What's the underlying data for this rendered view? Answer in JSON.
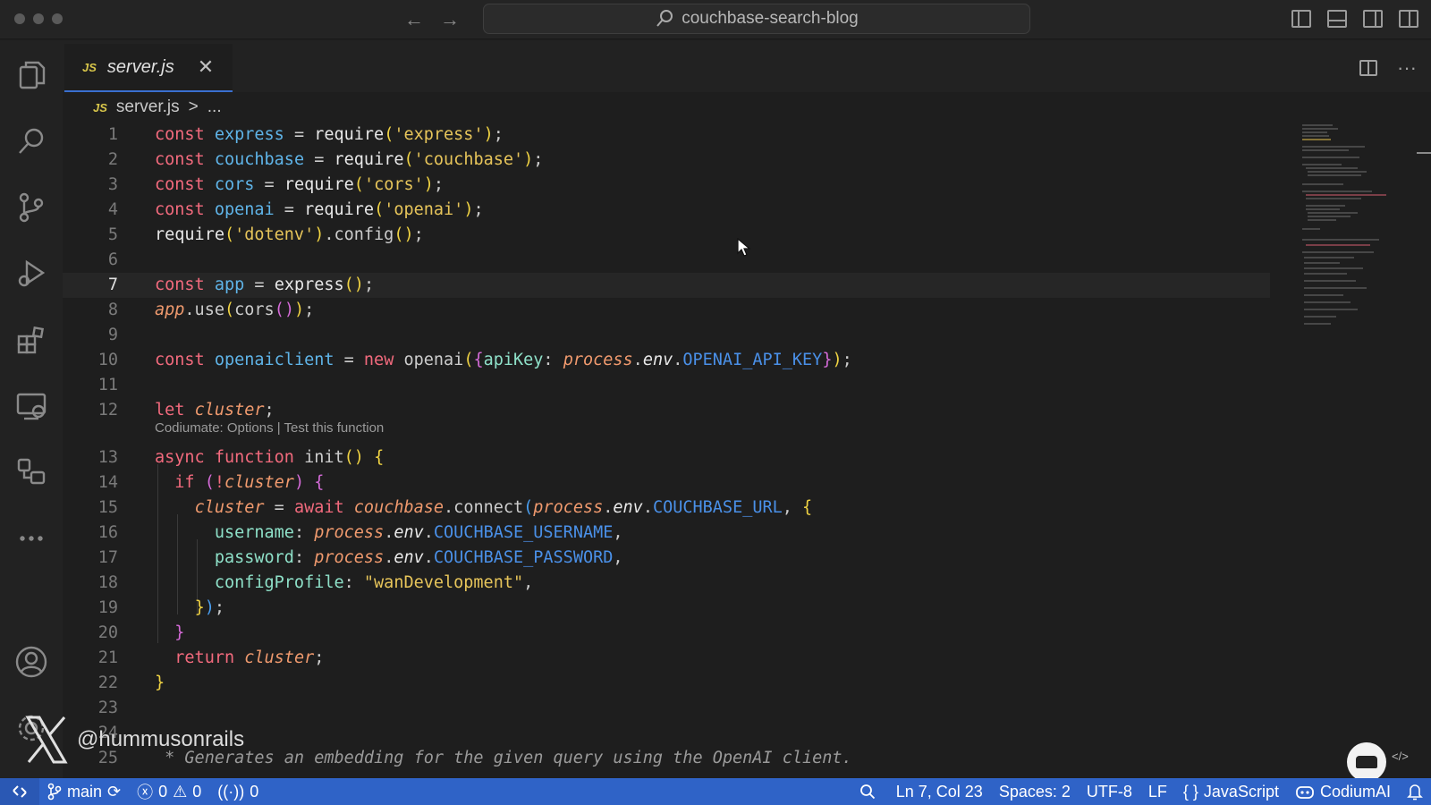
{
  "window": {
    "search_title": "couchbase-search-blog",
    "back_glyph": "←",
    "forward_glyph": "→"
  },
  "tab": {
    "badge": "JS",
    "title": "server.js",
    "close_glyph": "✕",
    "more_glyph": "···"
  },
  "breadcrumb": {
    "badge": "JS",
    "file": "server.js",
    "separator": ">",
    "more": "..."
  },
  "editor": {
    "current_line": 7,
    "line_numbers": [
      "1",
      "2",
      "3",
      "4",
      "5",
      "6",
      "7",
      "8",
      "9",
      "10",
      "11",
      "12",
      "13",
      "14",
      "15",
      "16",
      "17",
      "18",
      "19",
      "20",
      "21",
      "22",
      "23",
      "24",
      "25"
    ],
    "codelens": "Codiumate: Options | Test this function",
    "code": {
      "l1": [
        {
          "t": "const",
          "c": "kw"
        },
        {
          "t": " "
        },
        {
          "t": "express",
          "c": "var"
        },
        {
          "t": " = "
        },
        {
          "t": "require",
          "c": "fn"
        },
        {
          "t": "(",
          "c": "br"
        },
        {
          "t": "'express'",
          "c": "str"
        },
        {
          "t": ")",
          "c": "br"
        },
        {
          "t": ";"
        }
      ],
      "l2": [
        {
          "t": "const",
          "c": "kw"
        },
        {
          "t": " "
        },
        {
          "t": "couchbase",
          "c": "var"
        },
        {
          "t": " = "
        },
        {
          "t": "require",
          "c": "fn"
        },
        {
          "t": "(",
          "c": "br"
        },
        {
          "t": "'couchbase'",
          "c": "str"
        },
        {
          "t": ")",
          "c": "br"
        },
        {
          "t": ";"
        }
      ],
      "l3": [
        {
          "t": "const",
          "c": "kw"
        },
        {
          "t": " "
        },
        {
          "t": "cors",
          "c": "var"
        },
        {
          "t": " = "
        },
        {
          "t": "require",
          "c": "fn"
        },
        {
          "t": "(",
          "c": "br"
        },
        {
          "t": "'cors'",
          "c": "str"
        },
        {
          "t": ")",
          "c": "br"
        },
        {
          "t": ";"
        }
      ],
      "l4": [
        {
          "t": "const",
          "c": "kw"
        },
        {
          "t": " "
        },
        {
          "t": "openai",
          "c": "var"
        },
        {
          "t": " = "
        },
        {
          "t": "require",
          "c": "fn"
        },
        {
          "t": "(",
          "c": "br"
        },
        {
          "t": "'openai'",
          "c": "str"
        },
        {
          "t": ")",
          "c": "br"
        },
        {
          "t": ";"
        }
      ],
      "l5": [
        {
          "t": "require",
          "c": "fn"
        },
        {
          "t": "(",
          "c": "br"
        },
        {
          "t": "'dotenv'",
          "c": "str"
        },
        {
          "t": ")",
          "c": "br"
        },
        {
          "t": ".config"
        },
        {
          "t": "()",
          "c": "br"
        },
        {
          "t": ";"
        }
      ],
      "l6": [],
      "l7": [
        {
          "t": "const",
          "c": "kw"
        },
        {
          "t": " "
        },
        {
          "t": "app",
          "c": "var"
        },
        {
          "t": " = "
        },
        {
          "t": "express",
          "c": "fn"
        },
        {
          "t": "()",
          "c": "br"
        },
        {
          "t": ";"
        }
      ],
      "l8": [
        {
          "t": "app",
          "c": "it"
        },
        {
          "t": ".use"
        },
        {
          "t": "(",
          "c": "br"
        },
        {
          "t": "cors"
        },
        {
          "t": "()",
          "c": "br2"
        },
        {
          "t": ")",
          "c": "br"
        },
        {
          "t": ";"
        }
      ],
      "l9": [],
      "l10": [
        {
          "t": "const",
          "c": "kw"
        },
        {
          "t": " "
        },
        {
          "t": "openaiclient",
          "c": "var"
        },
        {
          "t": " = "
        },
        {
          "t": "new",
          "c": "kw"
        },
        {
          "t": " openai"
        },
        {
          "t": "(",
          "c": "br"
        },
        {
          "t": "{",
          "c": "br2"
        },
        {
          "t": "apiKey",
          "c": "prop"
        },
        {
          "t": ": "
        },
        {
          "t": "process",
          "c": "it"
        },
        {
          "t": "."
        },
        {
          "t": "env",
          "c": "itw"
        },
        {
          "t": "."
        },
        {
          "t": "OPENAI_API_KEY",
          "c": "cst"
        },
        {
          "t": "}",
          "c": "br2"
        },
        {
          "t": ")",
          "c": "br"
        },
        {
          "t": ";"
        }
      ],
      "l11": [],
      "l12": [
        {
          "t": "let",
          "c": "kw"
        },
        {
          "t": " "
        },
        {
          "t": "cluster",
          "c": "it"
        },
        {
          "t": ";"
        }
      ],
      "l13": [
        {
          "t": "async",
          "c": "kw"
        },
        {
          "t": " "
        },
        {
          "t": "function",
          "c": "kw"
        },
        {
          "t": " init"
        },
        {
          "t": "()",
          "c": "br"
        },
        {
          "t": " "
        },
        {
          "t": "{",
          "c": "br"
        }
      ],
      "l14": [
        {
          "t": "  "
        },
        {
          "t": "if",
          "c": "kw"
        },
        {
          "t": " "
        },
        {
          "t": "(",
          "c": "br2"
        },
        {
          "t": "!",
          "c": "kw"
        },
        {
          "t": "cluster",
          "c": "it"
        },
        {
          "t": ")",
          "c": "br2"
        },
        {
          "t": " "
        },
        {
          "t": "{",
          "c": "br2"
        }
      ],
      "l15": [
        {
          "t": "    "
        },
        {
          "t": "cluster",
          "c": "it"
        },
        {
          "t": " = "
        },
        {
          "t": "await",
          "c": "kw"
        },
        {
          "t": " "
        },
        {
          "t": "couchbase",
          "c": "it"
        },
        {
          "t": ".connect"
        },
        {
          "t": "(",
          "c": "br3"
        },
        {
          "t": "process",
          "c": "it"
        },
        {
          "t": "."
        },
        {
          "t": "env",
          "c": "itw"
        },
        {
          "t": "."
        },
        {
          "t": "COUCHBASE_URL",
          "c": "cst"
        },
        {
          "t": ", "
        },
        {
          "t": "{",
          "c": "br"
        }
      ],
      "l16": [
        {
          "t": "      "
        },
        {
          "t": "username",
          "c": "prop"
        },
        {
          "t": ": "
        },
        {
          "t": "process",
          "c": "it"
        },
        {
          "t": "."
        },
        {
          "t": "env",
          "c": "itw"
        },
        {
          "t": "."
        },
        {
          "t": "COUCHBASE_USERNAME",
          "c": "cst"
        },
        {
          "t": ","
        }
      ],
      "l17": [
        {
          "t": "      "
        },
        {
          "t": "password",
          "c": "prop"
        },
        {
          "t": ": "
        },
        {
          "t": "process",
          "c": "it"
        },
        {
          "t": "."
        },
        {
          "t": "env",
          "c": "itw"
        },
        {
          "t": "."
        },
        {
          "t": "COUCHBASE_PASSWORD",
          "c": "cst"
        },
        {
          "t": ","
        }
      ],
      "l18": [
        {
          "t": "      "
        },
        {
          "t": "configProfile",
          "c": "prop"
        },
        {
          "t": ": "
        },
        {
          "t": "\"wanDevelopment\"",
          "c": "str"
        },
        {
          "t": ","
        }
      ],
      "l19": [
        {
          "t": "    "
        },
        {
          "t": "}",
          "c": "br"
        },
        {
          "t": ")",
          "c": "br3"
        },
        {
          "t": ";"
        }
      ],
      "l20": [
        {
          "t": "  "
        },
        {
          "t": "}",
          "c": "br2"
        }
      ],
      "l21": [
        {
          "t": "  "
        },
        {
          "t": "return",
          "c": "kw"
        },
        {
          "t": " "
        },
        {
          "t": "cluster",
          "c": "it"
        },
        {
          "t": ";"
        }
      ],
      "l22": [
        {
          "t": "}",
          "c": "br"
        }
      ],
      "l23": [],
      "l24": [],
      "l25": [
        {
          "t": " * Generates an embedding for the given query using the OpenAI client.",
          "c": "cmt"
        }
      ]
    }
  },
  "watermark": {
    "handle": "@hummusonrails"
  },
  "float": {
    "small": "</>"
  },
  "statusbar": {
    "branch": "main",
    "errors": "0",
    "warnings": "0",
    "ports": "0",
    "position": "Ln 7, Col 23",
    "spaces": "Spaces: 2",
    "encoding": "UTF-8",
    "eol": "LF",
    "language_braces": "{ }",
    "language": "JavaScript",
    "extension": "CodiumAI"
  },
  "colors": {
    "accent": "#2f63c7",
    "keyword": "#f26a7d",
    "variable": "#5fb4e8",
    "string": "#e6c45a"
  },
  "icons": [
    "explorer-icon",
    "search-icon",
    "source-control-icon",
    "run-debug-icon",
    "extensions-icon",
    "remote-explorer-icon",
    "codiumate-icon",
    "more-icon",
    "account-icon",
    "settings-icon"
  ]
}
